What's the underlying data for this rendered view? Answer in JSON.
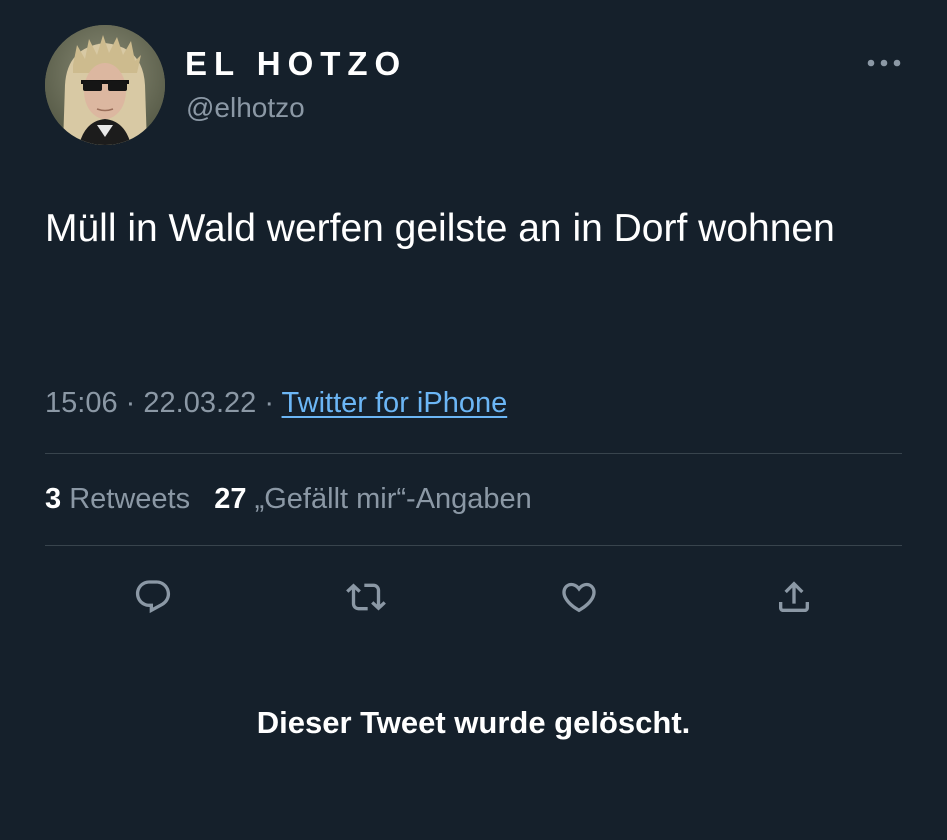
{
  "author": {
    "display_name": "EL HOTZO",
    "handle": "@elhotzo"
  },
  "tweet": {
    "text": "Müll in Wald werfen geilste an in Dorf wohnen",
    "time": "15:06",
    "date": "22.03.22",
    "separator": "·",
    "source": "Twitter for iPhone"
  },
  "stats": {
    "retweets_count": "3",
    "retweets_label": "Retweets",
    "likes_count": "27",
    "likes_label": "„Gefällt mir“-Angaben"
  },
  "actions": {
    "icons": [
      "reply-icon",
      "retweet-icon",
      "like-icon",
      "share-icon"
    ]
  },
  "notice": {
    "deleted_text": "Dieser Tweet wurde gelöscht."
  },
  "colors": {
    "background": "#15202b",
    "text_primary": "#ffffff",
    "text_secondary": "#8b98a5",
    "link": "#6cb6f5",
    "divider": "#38444d"
  }
}
